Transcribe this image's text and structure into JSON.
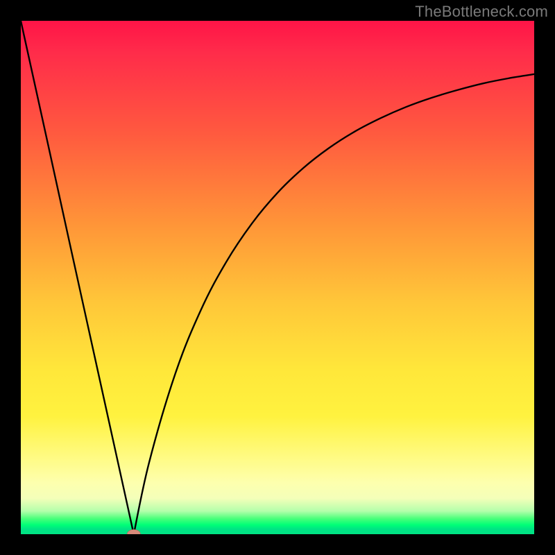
{
  "watermark": "TheBottleneck.com",
  "colors": {
    "frame": "#000000",
    "curve": "#000000",
    "marker_fill": "#d88a7a",
    "gradient": [
      "#ff1447",
      "#ff5a3f",
      "#ff9638",
      "#ffc739",
      "#ffe73a",
      "#fffb83",
      "#b4ffab",
      "#00ff77",
      "#00e384"
    ]
  },
  "chart_data": {
    "type": "line",
    "title": "",
    "xlabel": "",
    "ylabel": "",
    "xlim": [
      0,
      100
    ],
    "ylim": [
      0,
      100
    ],
    "legend": false,
    "grid": false,
    "description": "Bottleneck-style V curve: steep linear descent from top-left to a minimum near x≈22, then a saturating rise toward the right. Background is a red→yellow→green vertical gradient (green = low bottleneck).",
    "min_point": {
      "x": 22,
      "y": 0
    },
    "series": [
      {
        "name": "bottleneck-curve",
        "x": [
          0,
          5,
          10,
          15,
          20,
          22,
          25,
          30,
          35,
          40,
          45,
          50,
          55,
          60,
          65,
          70,
          75,
          80,
          85,
          90,
          95,
          100
        ],
        "y": [
          100,
          77.3,
          54.5,
          31.8,
          9.1,
          0.0,
          14.0,
          31.0,
          43.5,
          53.0,
          60.5,
          66.5,
          71.3,
          75.2,
          78.4,
          81.0,
          83.2,
          85.0,
          86.5,
          87.8,
          88.8,
          89.6
        ]
      }
    ],
    "marker": {
      "x": 22,
      "y": 0,
      "shape": "ellipse",
      "rx": 1.3,
      "ry": 0.9
    }
  }
}
